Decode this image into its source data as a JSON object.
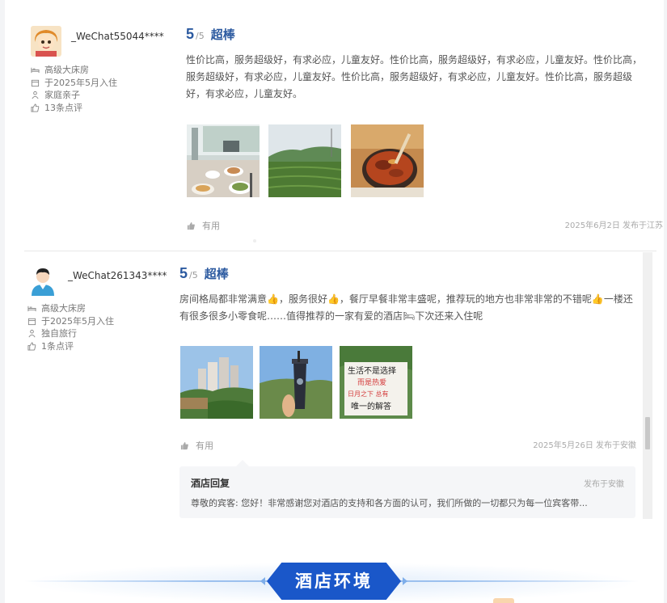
{
  "reviews": [
    {
      "username": "_WeChat55044****",
      "meta": [
        "高级大床房",
        "于2025年5月入住",
        "家庭亲子",
        "13条点评"
      ],
      "score": "5",
      "score_max": "/5",
      "score_word": "超棒",
      "text": "性价比高，服务超级好，有求必应，儿童友好。性价比高，服务超级好，有求必应，儿童友好。性价比高，服务超级好，有求必应，儿童友好。性价比高，服务超级好，有求必应，儿童友好。性价比高，服务超级好，有求必应，儿童友好。",
      "useful_label": "有用",
      "post_info": "2025年6月2日 发布于江苏"
    },
    {
      "username": "_WeChat261343****",
      "meta": [
        "高级大床房",
        "于2025年5月入住",
        "独自旅行",
        "1条点评"
      ],
      "score": "5",
      "score_max": "/5",
      "score_word": "超棒",
      "text": "房间格局都非常满意👍，服务很好👍，餐厅早餐非常丰盛呢，推荐玩的地方也非常非常的不错呢👍一楼还有很多很多小零食呢……值得推荐的一家有爱的酒店🛏下次还来入住呢",
      "useful_label": "有用",
      "post_info": "2025年5月26日 发布于安徽",
      "photo_sign_lines": [
        "生活不是选择",
        "而是热爱",
        "日月之下 总有",
        "唯一的解答"
      ],
      "reply": {
        "title": "酒店回复",
        "location": "发布于安徽",
        "text": "尊敬的宾客: 您好！非常感谢您对酒店的支持和各方面的认可，我们所做的一切都只为每一位宾客带..."
      }
    }
  ],
  "section": {
    "title": "酒店环境"
  },
  "colors": {
    "accent": "#2c5aa0",
    "section_blue": "#1a57c9"
  },
  "icons": [
    "bed-icon",
    "calendar-icon",
    "traveler-icon",
    "review-count-icon",
    "thumbs-up-icon"
  ]
}
